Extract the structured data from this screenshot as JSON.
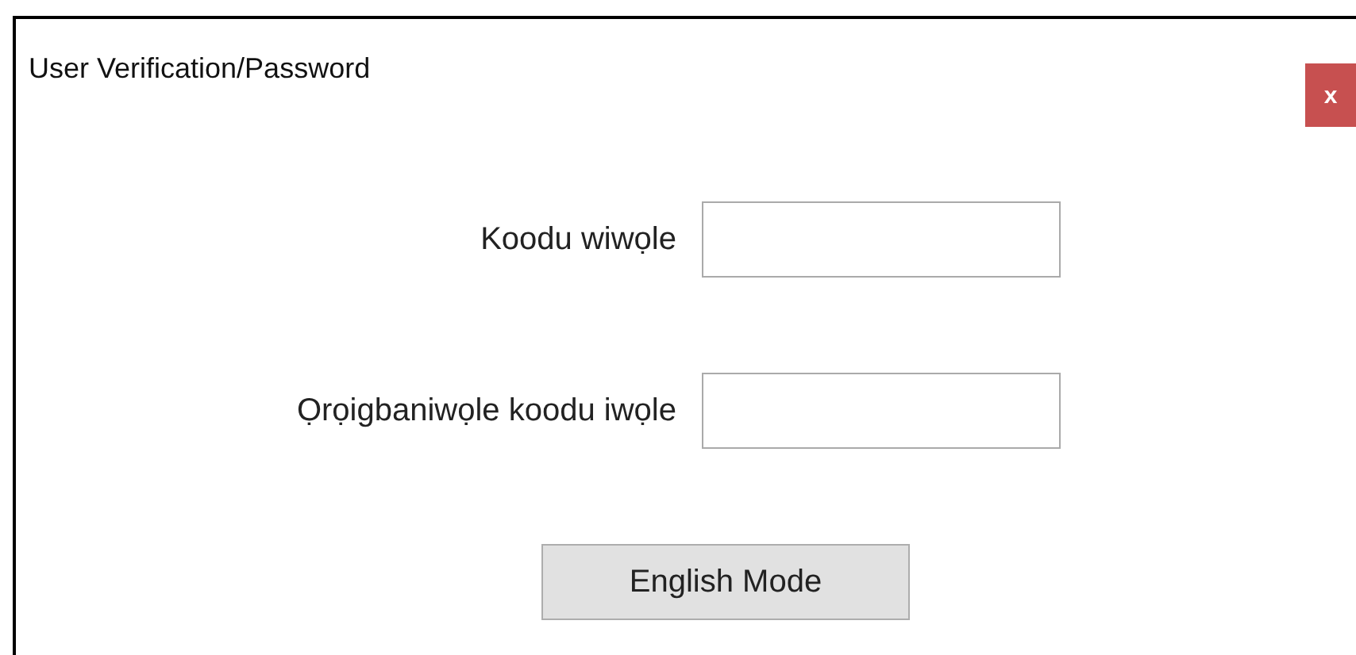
{
  "window": {
    "title": "User Verification/Password",
    "close": "x"
  },
  "fields": [
    {
      "label": "Koodu wiwọle"
    },
    {
      "label": "Ọrọigbaniwọle koodu iwọle"
    }
  ],
  "buttons": [
    "English Mode"
  ]
}
